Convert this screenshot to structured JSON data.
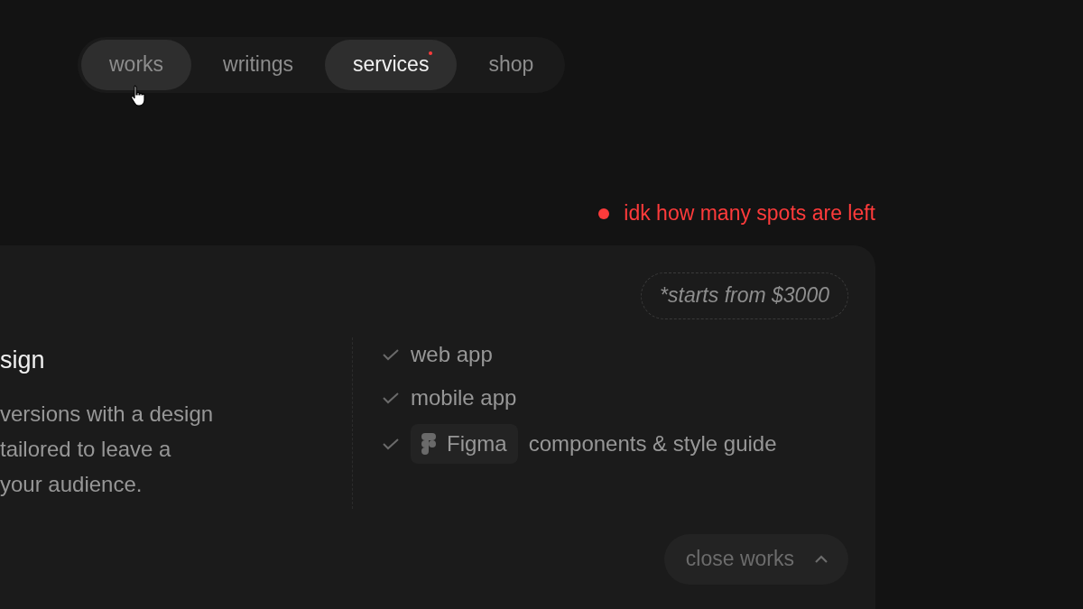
{
  "nav": {
    "tabs": [
      {
        "label": "works",
        "selected": false,
        "hovered": true,
        "dot": false
      },
      {
        "label": "writings",
        "selected": false,
        "hovered": false,
        "dot": false
      },
      {
        "label": "services",
        "selected": true,
        "hovered": false,
        "dot": true
      },
      {
        "label": "shop",
        "selected": false,
        "hovered": false,
        "dot": false
      }
    ]
  },
  "availability": "idk how many spots are left",
  "card": {
    "price": "*starts from $3000",
    "title": "sign",
    "description": [
      "versions with a design",
      "tailored to leave a",
      "your audience."
    ],
    "features": [
      {
        "kind": "text",
        "label": "web app"
      },
      {
        "kind": "text",
        "label": "mobile app"
      },
      {
        "kind": "tool",
        "tool": "Figma",
        "label": "components & style guide"
      }
    ],
    "close_button": "close works"
  }
}
